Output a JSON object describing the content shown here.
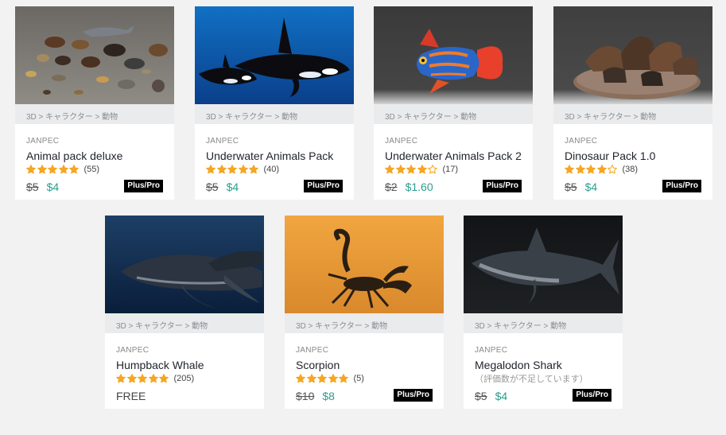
{
  "cards": [
    {
      "id": "animal-pack-deluxe",
      "category": "3D > キャラクター > 動物",
      "publisher": "JANPEC",
      "title": "Animal pack deluxe",
      "rating": 5,
      "rating_count": "(55)",
      "old_price": "$5",
      "price": "$4",
      "badge": "Plus/Pro"
    },
    {
      "id": "underwater-animals-pack",
      "category": "3D > キャラクター > 動物",
      "publisher": "JANPEC",
      "title": "Underwater Animals Pack",
      "rating": 5,
      "rating_count": "(40)",
      "old_price": "$5",
      "price": "$4",
      "badge": "Plus/Pro"
    },
    {
      "id": "underwater-animals-pack-2",
      "category": "3D > キャラクター > 動物",
      "publisher": "JANPEC",
      "title": "Underwater Animals Pack 2",
      "rating": 4,
      "rating_count": "(17)",
      "old_price": "$2",
      "price": "$1.60",
      "badge": "Plus/Pro"
    },
    {
      "id": "dinosaur-pack",
      "category": "3D > キャラクター > 動物",
      "publisher": "JANPEC",
      "title": "Dinosaur Pack 1.0",
      "rating": 4,
      "rating_count": "(38)",
      "old_price": "$5",
      "price": "$4",
      "badge": "Plus/Pro"
    },
    {
      "id": "humpback-whale",
      "category": "3D > キャラクター > 動物",
      "publisher": "JANPEC",
      "title": "Humpback Whale",
      "rating": 5,
      "rating_count": "(205)",
      "free_label": "FREE"
    },
    {
      "id": "scorpion",
      "category": "3D > キャラクター > 動物",
      "publisher": "JANPEC",
      "title": "Scorpion",
      "rating": 5,
      "rating_count": "(5)",
      "old_price": "$10",
      "price": "$8",
      "badge": "Plus/Pro"
    },
    {
      "id": "megalodon-shark",
      "category": "3D > キャラクター > 動物",
      "publisher": "JANPEC",
      "title": "Megalodon Shark",
      "no_rating_text": "（評価数が不足しています）",
      "old_price": "$5",
      "price": "$4",
      "badge": "Plus/Pro"
    }
  ],
  "colors": {
    "page_background": "#f2f2f2",
    "card_background": "#ffffff",
    "category_bar": "#eaebec",
    "sale_price": "#2a9d8f",
    "star": "#f5a623",
    "badge_background": "#000000"
  }
}
